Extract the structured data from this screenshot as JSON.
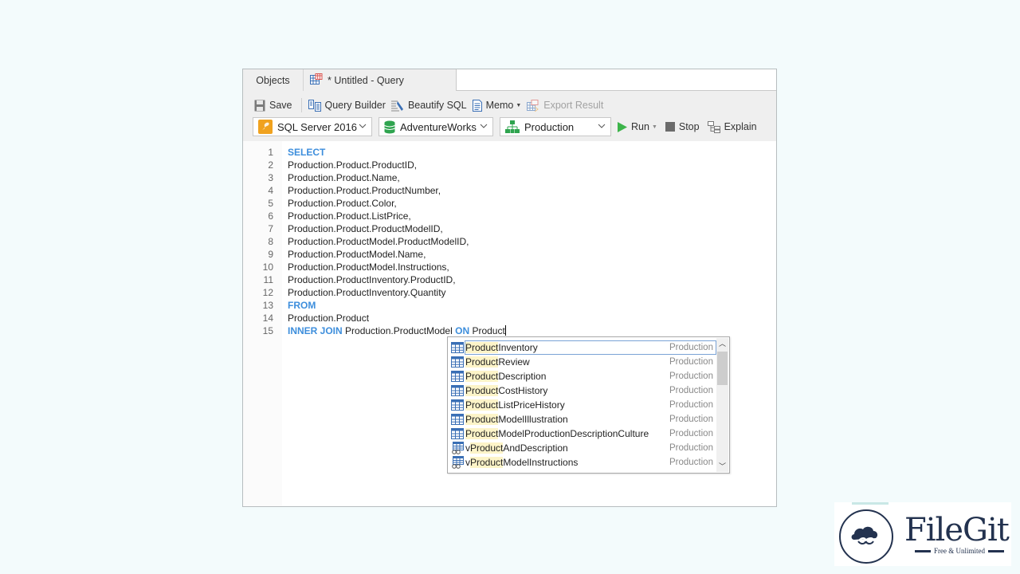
{
  "tabs": {
    "objects": "Objects",
    "query": "* Untitled - Query"
  },
  "toolbar": {
    "save": "Save",
    "query_builder": "Query Builder",
    "beautify_sql": "Beautify SQL",
    "memo": "Memo",
    "export_result": "Export Result",
    "run": "Run",
    "stop": "Stop",
    "explain": "Explain"
  },
  "selectors": {
    "server": "SQL Server 2016",
    "database": "AdventureWorks",
    "schema": "Production"
  },
  "editor": {
    "lines": [
      {
        "num": "1",
        "kw": "SELECT",
        "text": ""
      },
      {
        "num": "2",
        "kw": "",
        "text": "Production.Product.ProductID,"
      },
      {
        "num": "3",
        "kw": "",
        "text": "Production.Product.Name,"
      },
      {
        "num": "4",
        "kw": "",
        "text": "Production.Product.ProductNumber,"
      },
      {
        "num": "5",
        "kw": "",
        "text": "Production.Product.Color,"
      },
      {
        "num": "6",
        "kw": "",
        "text": "Production.Product.ListPrice,"
      },
      {
        "num": "7",
        "kw": "",
        "text": "Production.Product.ProductModelID,"
      },
      {
        "num": "8",
        "kw": "",
        "text": "Production.ProductModel.ProductModelID,"
      },
      {
        "num": "9",
        "kw": "",
        "text": "Production.ProductModel.Name,"
      },
      {
        "num": "10",
        "kw": "",
        "text": "Production.ProductModel.Instructions,"
      },
      {
        "num": "11",
        "kw": "",
        "text": "Production.ProductInventory.ProductID,"
      },
      {
        "num": "12",
        "kw": "",
        "text": "Production.ProductInventory.Quantity"
      },
      {
        "num": "13",
        "kw": "FROM",
        "text": ""
      },
      {
        "num": "14",
        "kw": "",
        "text": "Production.Product"
      }
    ],
    "last_line": {
      "num": "15",
      "kw1": "INNER JOIN",
      "text1": " Production.ProductModel ",
      "kw2": "ON",
      "text2": " Product"
    }
  },
  "autocomplete": {
    "match": "Product",
    "items": [
      {
        "prefix": "",
        "match": "Product",
        "rest": "Inventory",
        "schema": "Production",
        "type": "table",
        "selected": true
      },
      {
        "prefix": "",
        "match": "Product",
        "rest": "Review",
        "schema": "Production",
        "type": "table"
      },
      {
        "prefix": "",
        "match": "Product",
        "rest": "Description",
        "schema": "Production",
        "type": "table"
      },
      {
        "prefix": "",
        "match": "Product",
        "rest": "CostHistory",
        "schema": "Production",
        "type": "table"
      },
      {
        "prefix": "",
        "match": "Product",
        "rest": "ListPriceHistory",
        "schema": "Production",
        "type": "table"
      },
      {
        "prefix": "",
        "match": "Product",
        "rest": "ModelIllustration",
        "schema": "Production",
        "type": "table"
      },
      {
        "prefix": "",
        "match": "Product",
        "rest": "ModelProductionDescriptionCulture",
        "schema": "Production",
        "type": "table"
      },
      {
        "prefix": "v",
        "match": "Product",
        "rest": "AndDescription",
        "schema": "Production",
        "type": "view"
      },
      {
        "prefix": "v",
        "match": "Product",
        "rest": "ModelInstructions",
        "schema": "Production",
        "type": "view"
      }
    ]
  },
  "watermark": {
    "title": "FileGit",
    "subtitle": "Free & Unlimited"
  },
  "colors": {
    "keyword": "#3d8edc",
    "highlight": "#fdf4c8",
    "run_green": "#3cb44a"
  }
}
